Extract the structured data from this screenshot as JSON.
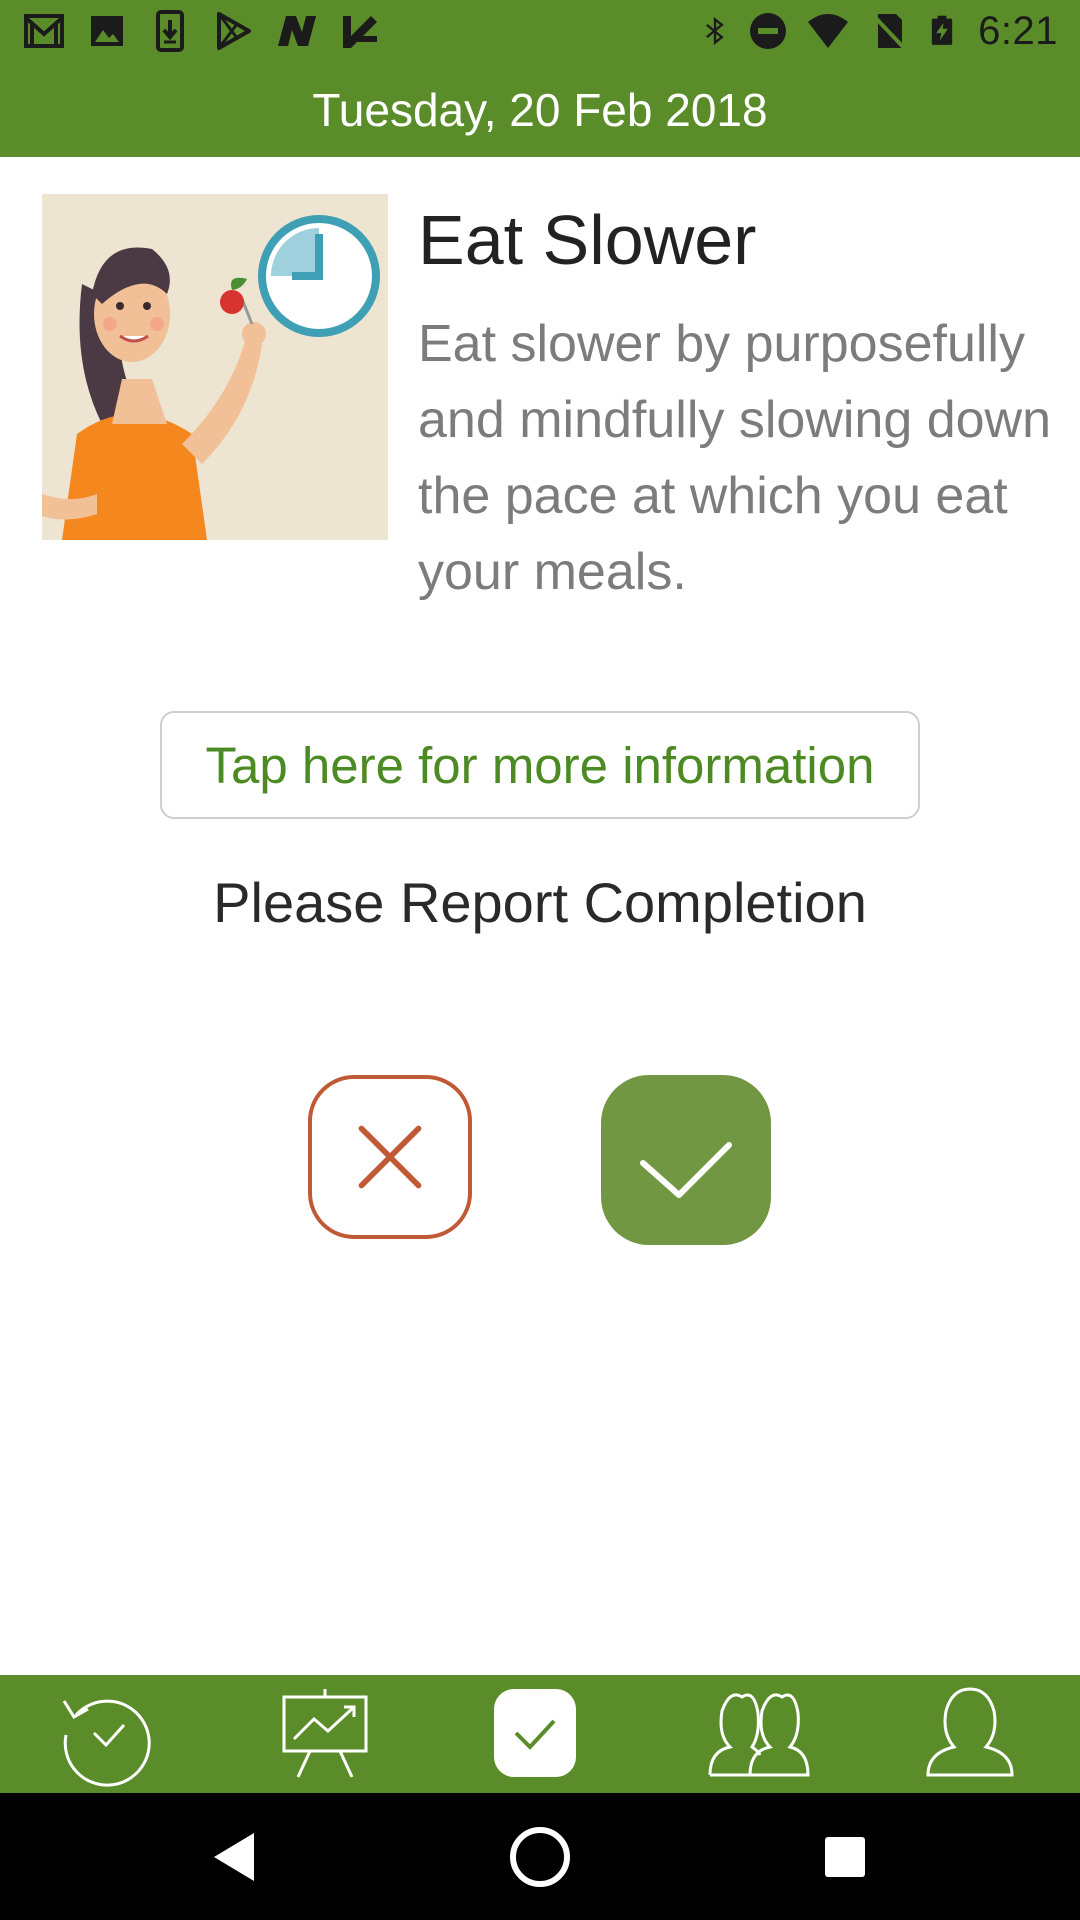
{
  "status_bar": {
    "time": "6:21",
    "left_icons": [
      "gmail-icon",
      "photos-icon",
      "download-icon",
      "play-store-icon",
      "n-app-icon",
      "check-app-icon"
    ],
    "right_icons": [
      "bluetooth-icon",
      "do-not-disturb-icon",
      "wifi-icon",
      "no-sim-icon",
      "battery-charging-icon"
    ]
  },
  "header": {
    "date": "Tuesday, 20 Feb 2018"
  },
  "habit": {
    "title": "Eat Slower",
    "description": "Eat slower by purposefully and mindfully slowing down the pace at which you eat your meals.",
    "illustration": "woman-eating-with-clock-illustration"
  },
  "more_info_button": "Tap here for more information",
  "report_prompt": "Please Report Completion",
  "actions": {
    "not_completed_icon": "x-icon",
    "completed_icon": "checkmark-icon"
  },
  "bottom_nav": {
    "items": [
      "history-icon",
      "progress-chart-icon",
      "daily-check-icon",
      "community-icon",
      "profile-icon"
    ],
    "active_index": 2
  },
  "system_nav": [
    "back-icon",
    "home-icon",
    "recents-icon"
  ],
  "colors": {
    "primary_green": "#5a8c29",
    "button_green": "#729742",
    "link_green": "#4c8a23",
    "cancel_orange": "#c05a36",
    "description_gray": "#7c7c7c"
  }
}
